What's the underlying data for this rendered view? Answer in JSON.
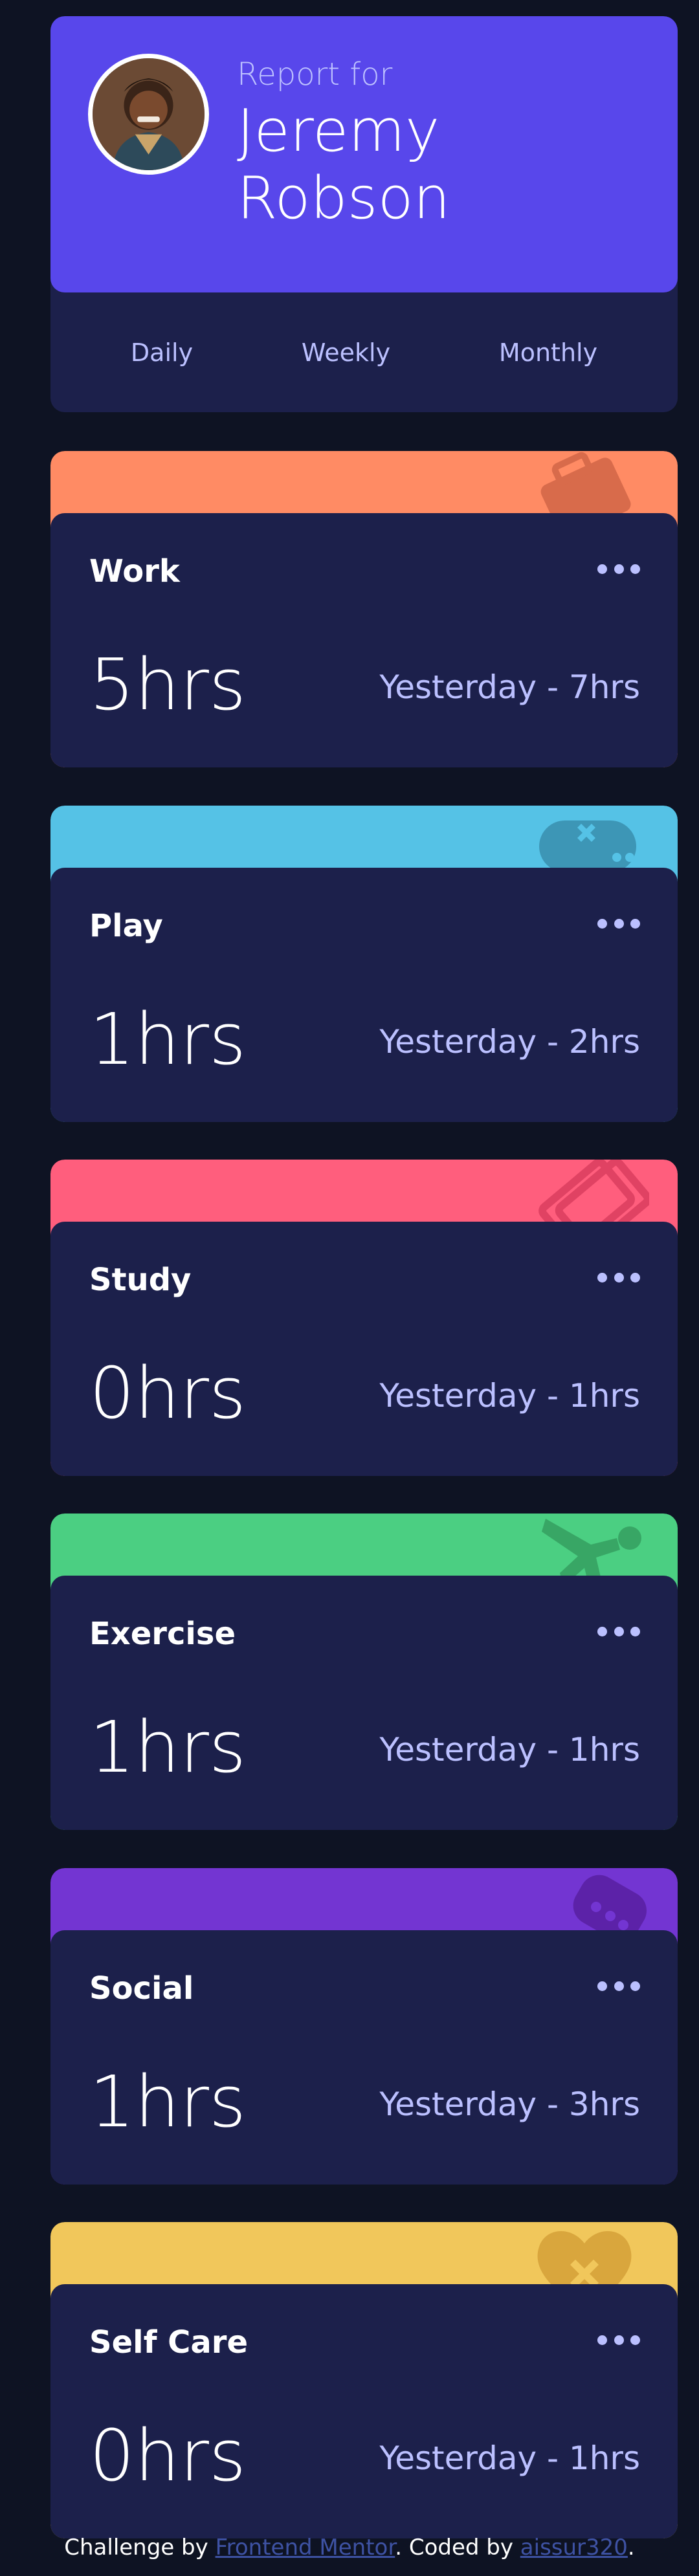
{
  "profile": {
    "report_for": "Report for",
    "first_name": "Jeremy",
    "last_name": "Robson",
    "tabs": [
      "Daily",
      "Weekly",
      "Monthly"
    ]
  },
  "colors": {
    "page_bg": "#0e1323",
    "card_bg": "#1c204b",
    "profile_accent": "#5847eb",
    "muted_text": "#bbc0ff"
  },
  "cards": [
    {
      "title": "Work",
      "current": "5hrs",
      "previous": "Yesterday - 7hrs",
      "color": "#ff8b64",
      "icon": "briefcase-icon"
    },
    {
      "title": "Play",
      "current": "1hrs",
      "previous": "Yesterday - 2hrs",
      "color": "#55c2e6",
      "icon": "gamepad-icon"
    },
    {
      "title": "Study",
      "current": "0hrs",
      "previous": "Yesterday - 1hrs",
      "color": "#ff5e7d",
      "icon": "book-icon"
    },
    {
      "title": "Exercise",
      "current": "1hrs",
      "previous": "Yesterday - 1hrs",
      "color": "#4bcf82",
      "icon": "running-icon"
    },
    {
      "title": "Social",
      "current": "1hrs",
      "previous": "Yesterday - 3hrs",
      "color": "#7335d2",
      "icon": "chat-icon"
    },
    {
      "title": "Self Care",
      "current": "0hrs",
      "previous": "Yesterday - 1hrs",
      "color": "#f1c75b",
      "icon": "heart-icon"
    }
  ],
  "footer": {
    "prefix": "Challenge by ",
    "link1": "Frontend Mentor",
    "middle": ". Coded by ",
    "link2": "aissur320",
    "suffix": "."
  }
}
